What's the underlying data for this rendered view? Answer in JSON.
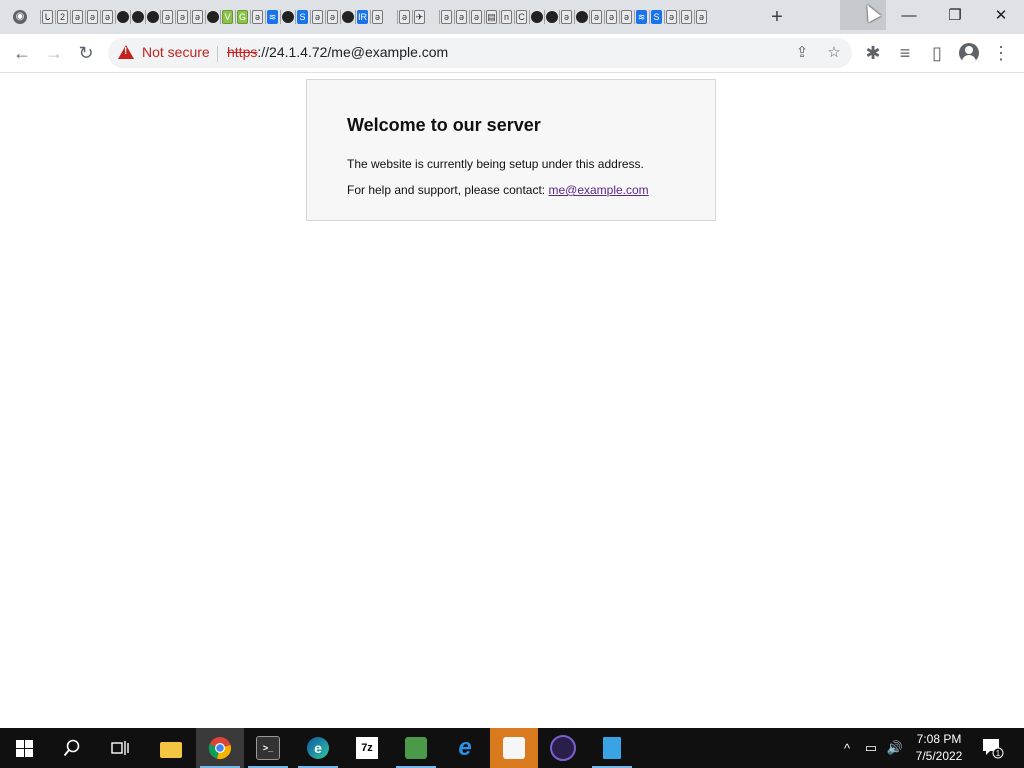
{
  "browser": {
    "new_tab_symbol": "+",
    "window_controls": {
      "minimize": "—",
      "restore": "❐",
      "close": "✕"
    },
    "toolbar": {
      "back": "←",
      "forward": "→",
      "reload": "↻",
      "menu": "⋮"
    },
    "omnibox": {
      "security_label": "Not secure",
      "url_scheme": "https",
      "url_rest": "://24.1.4.72/me@example.com",
      "share_icon": "share-icon",
      "bookmark_icon": "star-icon"
    },
    "extensions_icon": "puzzle-icon",
    "media_icon": "media-control-icon",
    "side_panel_icon": "side-panel-icon",
    "profile_icon": "profile-avatar-icon"
  },
  "tabs_group_a": [
    "ᒐ",
    "2",
    "ə",
    "ə",
    "ə",
    "●",
    "●",
    "●",
    "ə",
    "ə",
    "ə",
    "●",
    "V",
    "G",
    "ə",
    "≋",
    "●",
    "S",
    "ə",
    "ə",
    "●",
    "IR",
    "ə"
  ],
  "tabs_group_b": [
    "ə",
    "✈"
  ],
  "tabs_group_c": [
    "ə",
    "ə",
    "ə",
    "▤",
    "n",
    "C",
    "●",
    "●",
    "ə",
    "●",
    "ə",
    "ə",
    "ə",
    "≋",
    "S",
    "ə",
    "ə",
    "ə"
  ],
  "page": {
    "heading": "Welcome to our server",
    "line1": "The website is currently being setup under this address.",
    "line2_prefix": "For help and support, please contact: ",
    "contact_link": "me@example.com"
  },
  "taskbar": {
    "search_icon": "search-icon",
    "task_view_icon": "task-view-icon",
    "apps": [
      {
        "name": "file-explorer",
        "label": ""
      },
      {
        "name": "chrome",
        "label": ""
      },
      {
        "name": "terminal",
        "label": ">_"
      },
      {
        "name": "edge",
        "label": "e"
      },
      {
        "name": "7zip",
        "label": "7z"
      },
      {
        "name": "network-tool",
        "label": ""
      },
      {
        "name": "internet-explorer",
        "label": "e"
      },
      {
        "name": "security-tool",
        "label": ""
      },
      {
        "name": "eclipse-tool",
        "label": ""
      },
      {
        "name": "notepad",
        "label": ""
      }
    ],
    "tray": {
      "chevron": "^",
      "network": "▭",
      "volume": "🔊"
    },
    "time": "7:08 PM",
    "date": "7/5/2022",
    "notification_count": "1"
  }
}
